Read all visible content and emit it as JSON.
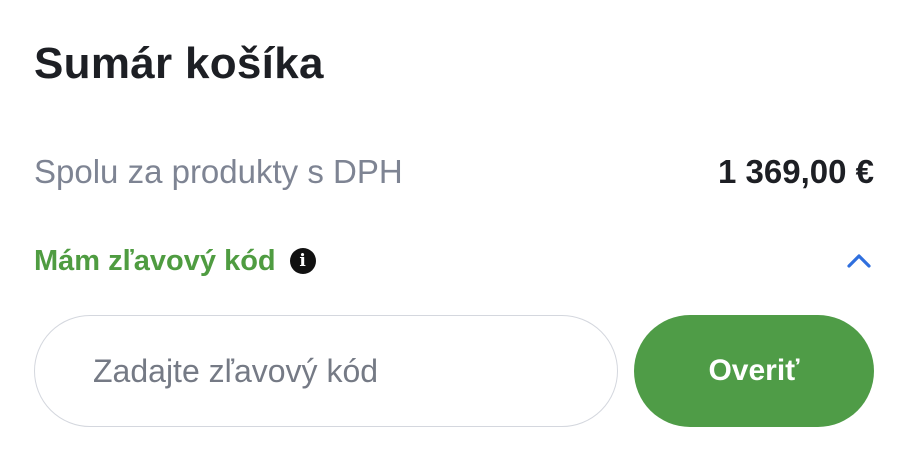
{
  "cart_summary": {
    "title": "Sumár košíka",
    "products_total_label": "Spolu za produkty s DPH",
    "products_total_value": "1 369,00 €"
  },
  "discount": {
    "toggle_label": "Mám zľavový kód",
    "info_icon": "info-icon",
    "toggle_icon": "chevron-up-icon",
    "expanded": true,
    "input_placeholder": "Zadajte zľavový kód",
    "input_value": "",
    "verify_button_label": "Overiť"
  },
  "colors": {
    "accent_green": "#4f9c47",
    "chevron_blue": "#2f6fde",
    "muted_text": "#7e8493",
    "primary_text": "#1d1f24"
  }
}
